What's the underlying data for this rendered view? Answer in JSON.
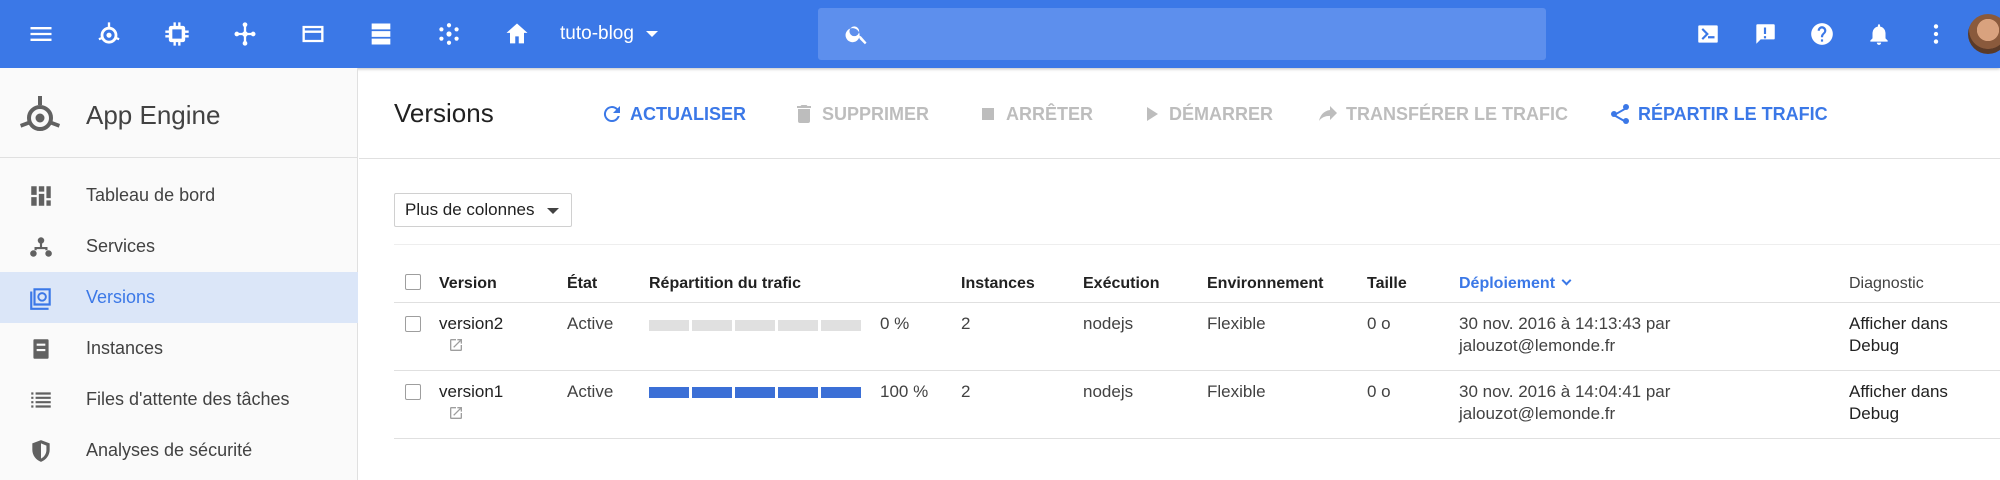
{
  "topbar": {
    "project": "tuto-blog",
    "search_placeholder": ""
  },
  "sidebar": {
    "title": "App Engine",
    "items": [
      {
        "label": "Tableau de bord",
        "icon": "dashboard-icon"
      },
      {
        "label": "Services",
        "icon": "services-icon"
      },
      {
        "label": "Versions",
        "icon": "versions-icon",
        "active": true
      },
      {
        "label": "Instances",
        "icon": "instances-icon"
      },
      {
        "label": "Files d'attente des tâches",
        "icon": "task-queues-icon"
      },
      {
        "label": "Analyses de sécurité",
        "icon": "security-scans-icon"
      }
    ]
  },
  "main": {
    "title": "Versions",
    "actions": [
      {
        "label": "ACTUALISER",
        "enabled": true,
        "icon": "refresh-icon"
      },
      {
        "label": "SUPPRIMER",
        "enabled": false,
        "icon": "trash-icon"
      },
      {
        "label": "ARRÊTER",
        "enabled": false,
        "icon": "stop-icon"
      },
      {
        "label": "DÉMARRER",
        "enabled": false,
        "icon": "play-icon"
      },
      {
        "label": "TRANSFÉRER LE TRAFIC",
        "enabled": false,
        "icon": "forward-icon"
      },
      {
        "label": "RÉPARTIR LE TRAFIC",
        "enabled": true,
        "icon": "share-icon"
      }
    ],
    "columns_button": "Plus de colonnes"
  },
  "table": {
    "headers": {
      "version": "Version",
      "state": "État",
      "traffic": "Répartition du trafic",
      "instances": "Instances",
      "runtime": "Exécution",
      "environment": "Environnement",
      "size": "Taille",
      "deployed": "Déploiement",
      "diagnostic": "Diagnostic"
    },
    "rows": [
      {
        "version": "version2",
        "state": "Active",
        "traffic_pct": 0,
        "traffic_label": "0 %",
        "instances": "2",
        "runtime": "nodejs",
        "environment": "Flexible",
        "size": "0 o",
        "deployed_line1": "30 nov. 2016 à 14:13:43 par",
        "deployed_line2": "jalouzot@lemonde.fr",
        "diag_line1": "Afficher dans",
        "diag_line2": "Debug"
      },
      {
        "version": "version1",
        "state": "Active",
        "traffic_pct": 100,
        "traffic_label": "100 %",
        "instances": "2",
        "runtime": "nodejs",
        "environment": "Flexible",
        "size": "0 o",
        "deployed_line1": "30 nov. 2016 à 14:04:41 par",
        "deployed_line2": "jalouzot@lemonde.fr",
        "diag_line1": "Afficher dans",
        "diag_line2": "Debug"
      }
    ]
  },
  "colors": {
    "brand_blue": "#3b78e7",
    "traffic_fill": "#3b6fd6",
    "traffic_empty": "#e0e0e0",
    "disabled": "#bdbdbd"
  }
}
